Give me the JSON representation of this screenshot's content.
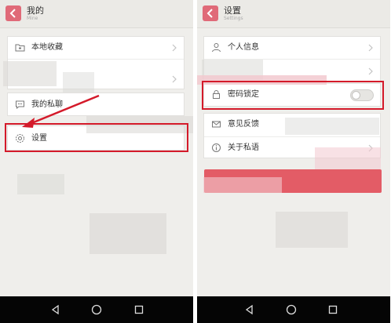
{
  "left_screen": {
    "title": "我的",
    "subtitle": "Mine",
    "items": [
      {
        "label": "本地收藏",
        "icon": "folder-icon"
      },
      {
        "label": "我的私聊",
        "icon": "chat-icon"
      },
      {
        "label": "设置",
        "icon": "settings-gear-icon"
      }
    ]
  },
  "right_screen": {
    "title": "设置",
    "subtitle": "Settings",
    "items": [
      {
        "label": "个人信息",
        "icon": "person-icon"
      },
      {
        "label": "密码锁定",
        "icon": "lock-icon",
        "toggle": "off"
      },
      {
        "label": "意见反馈",
        "icon": "mail-icon"
      },
      {
        "label": "关于私语",
        "icon": "info-icon"
      }
    ]
  },
  "colors": {
    "accent": "#e06a78",
    "highlight": "#d41a2a",
    "background": "#efeeeb",
    "navbar": "#050505"
  }
}
